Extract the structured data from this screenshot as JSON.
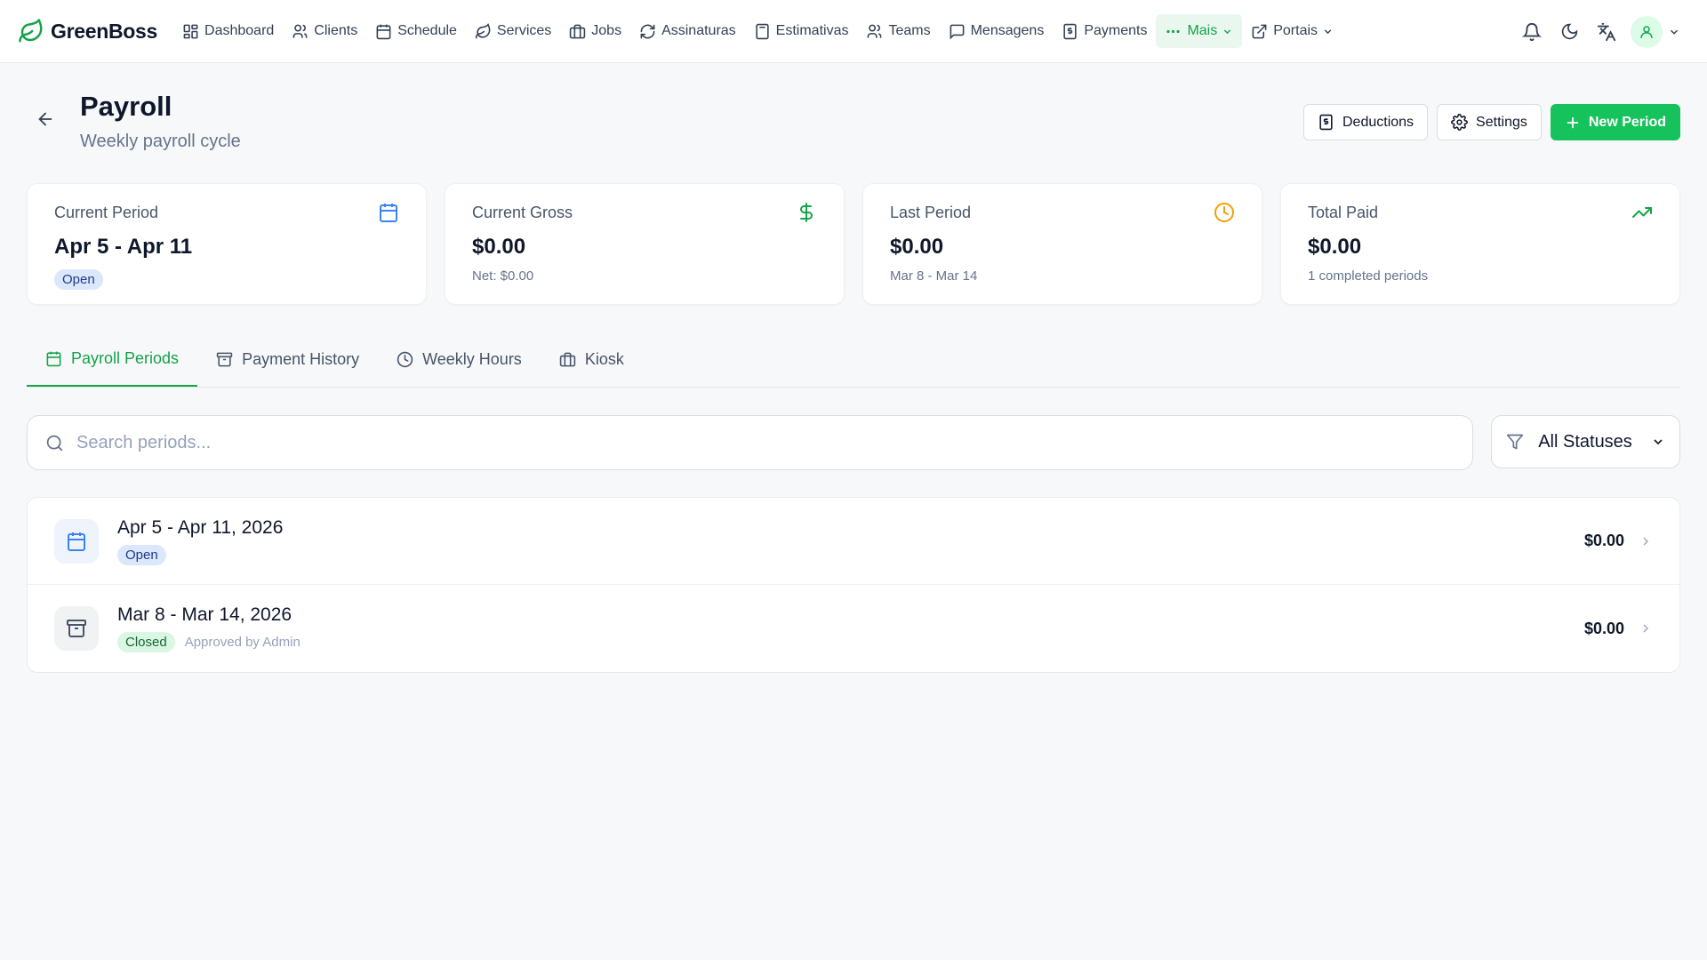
{
  "app": {
    "brand": "GreenBoss",
    "nav": [
      {
        "label": "Dashboard",
        "icon": "dashboard-icon"
      },
      {
        "label": "Clients",
        "icon": "users-icon"
      },
      {
        "label": "Schedule",
        "icon": "calendar-icon"
      },
      {
        "label": "Services",
        "icon": "leaf-icon"
      },
      {
        "label": "Jobs",
        "icon": "briefcase-icon"
      },
      {
        "label": "Assinaturas",
        "icon": "refresh-icon"
      },
      {
        "label": "Estimativas",
        "icon": "calculator-icon"
      },
      {
        "label": "Teams",
        "icon": "users-icon"
      },
      {
        "label": "Mensagens",
        "icon": "message-icon"
      },
      {
        "label": "Payments",
        "icon": "receipt-icon"
      },
      {
        "label": "Mais",
        "icon": "more-icon",
        "active": true
      },
      {
        "label": "Portais",
        "icon": "external-link-icon"
      }
    ]
  },
  "header": {
    "title": "Payroll",
    "subtitle": "Weekly payroll cycle",
    "buttons": {
      "deductions": "Deductions",
      "settings": "Settings",
      "new_period": "New Period"
    }
  },
  "stats": [
    {
      "label": "Current Period",
      "value": "Apr 5 - Apr 11",
      "badge": "Open",
      "icon": "calendar-icon",
      "color": "#3b82f6"
    },
    {
      "label": "Current Gross",
      "value": "$0.00",
      "sub": "Net: $0.00",
      "icon": "dollar-icon",
      "color": "#16a34a"
    },
    {
      "label": "Last Period",
      "value": "$0.00",
      "sub": "Mar 8 - Mar 14",
      "icon": "clock-icon",
      "color": "#f59e0b"
    },
    {
      "label": "Total Paid",
      "value": "$0.00",
      "sub": "1 completed periods",
      "icon": "trending-up-icon",
      "color": "#16a34a"
    }
  ],
  "tabs": [
    {
      "label": "Payroll Periods",
      "active": true
    },
    {
      "label": "Payment History"
    },
    {
      "label": "Weekly Hours"
    },
    {
      "label": "Kiosk"
    }
  ],
  "search": {
    "placeholder": "Search periods..."
  },
  "status_filter": {
    "value": "All Statuses"
  },
  "periods": [
    {
      "title": "Apr 5 - Apr 11, 2026",
      "status": "Open",
      "note": "",
      "amount": "$0.00"
    },
    {
      "title": "Mar 8 - Mar 14, 2026",
      "status": "Closed",
      "note": "Approved by Admin",
      "amount": "$0.00"
    }
  ]
}
